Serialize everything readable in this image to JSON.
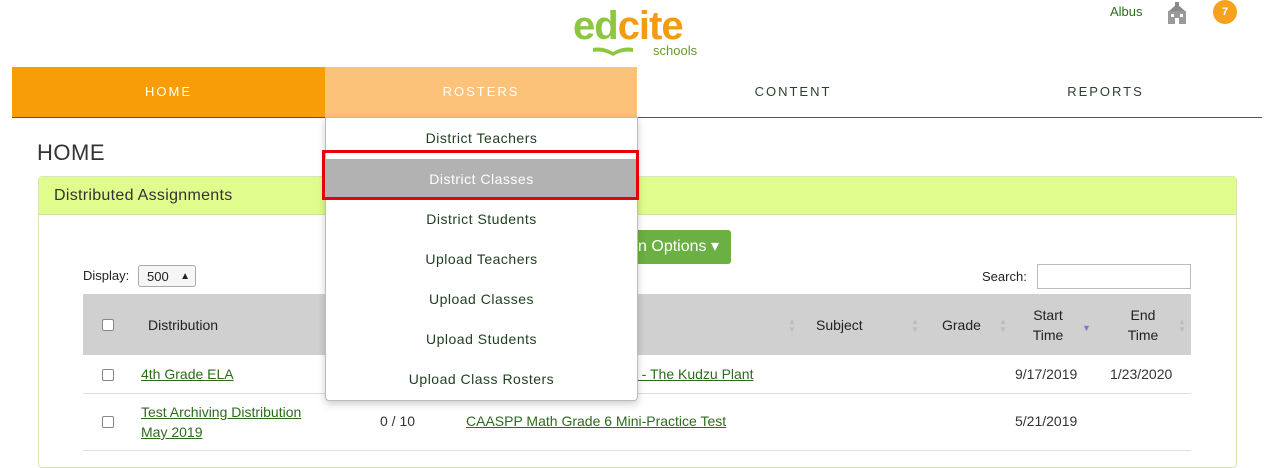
{
  "header": {
    "logo_ed": "ed",
    "logo_cite": "cite",
    "logo_sub": "schools",
    "user_name": "Albus",
    "notification_count": "7"
  },
  "nav": {
    "items": [
      {
        "label": "HOME"
      },
      {
        "label": "ROSTERS"
      },
      {
        "label": "CONTENT"
      },
      {
        "label": "REPORTS"
      }
    ]
  },
  "rosters_menu": {
    "items": [
      {
        "label": "District Teachers"
      },
      {
        "label": "District Classes"
      },
      {
        "label": "District Students"
      },
      {
        "label": "Upload Teachers"
      },
      {
        "label": "Upload Classes"
      },
      {
        "label": "Upload Students"
      },
      {
        "label": "Upload Class Rosters"
      }
    ]
  },
  "page": {
    "title": "HOME"
  },
  "panel": {
    "title": "Distributed Assignments",
    "options_button": "n Options ▾"
  },
  "controls": {
    "display_label": "Display:",
    "display_value": "500",
    "search_label": "Search:",
    "search_value": ""
  },
  "table": {
    "headers": {
      "distribution": "Distribution",
      "subject": "Subject",
      "grade": "Grade",
      "start_time": "Start Time",
      "end_time": "End Time"
    },
    "rows": [
      {
        "distribution": "4th Grade ELA",
        "progress": "",
        "content": "e - The Kudzu Plant",
        "subject": "",
        "grade": "",
        "start": "9/17/2019",
        "end": "1/23/2020"
      },
      {
        "distribution_line1": "Test Archiving Distribution",
        "distribution_line2": "May 2019",
        "progress": "0 / 10",
        "content": "CAASPP Math Grade 6 Mini-Practice Test",
        "subject": "",
        "grade": "",
        "start": "5/21/2019",
        "end": ""
      }
    ]
  },
  "colors": {
    "nav_home": "#f89d08",
    "nav_rosters": "#fcc27a",
    "panel_header": "#dffc8c",
    "options_button": "#6bb043",
    "link": "#2d6b1a",
    "highlight": "#e8000b"
  }
}
